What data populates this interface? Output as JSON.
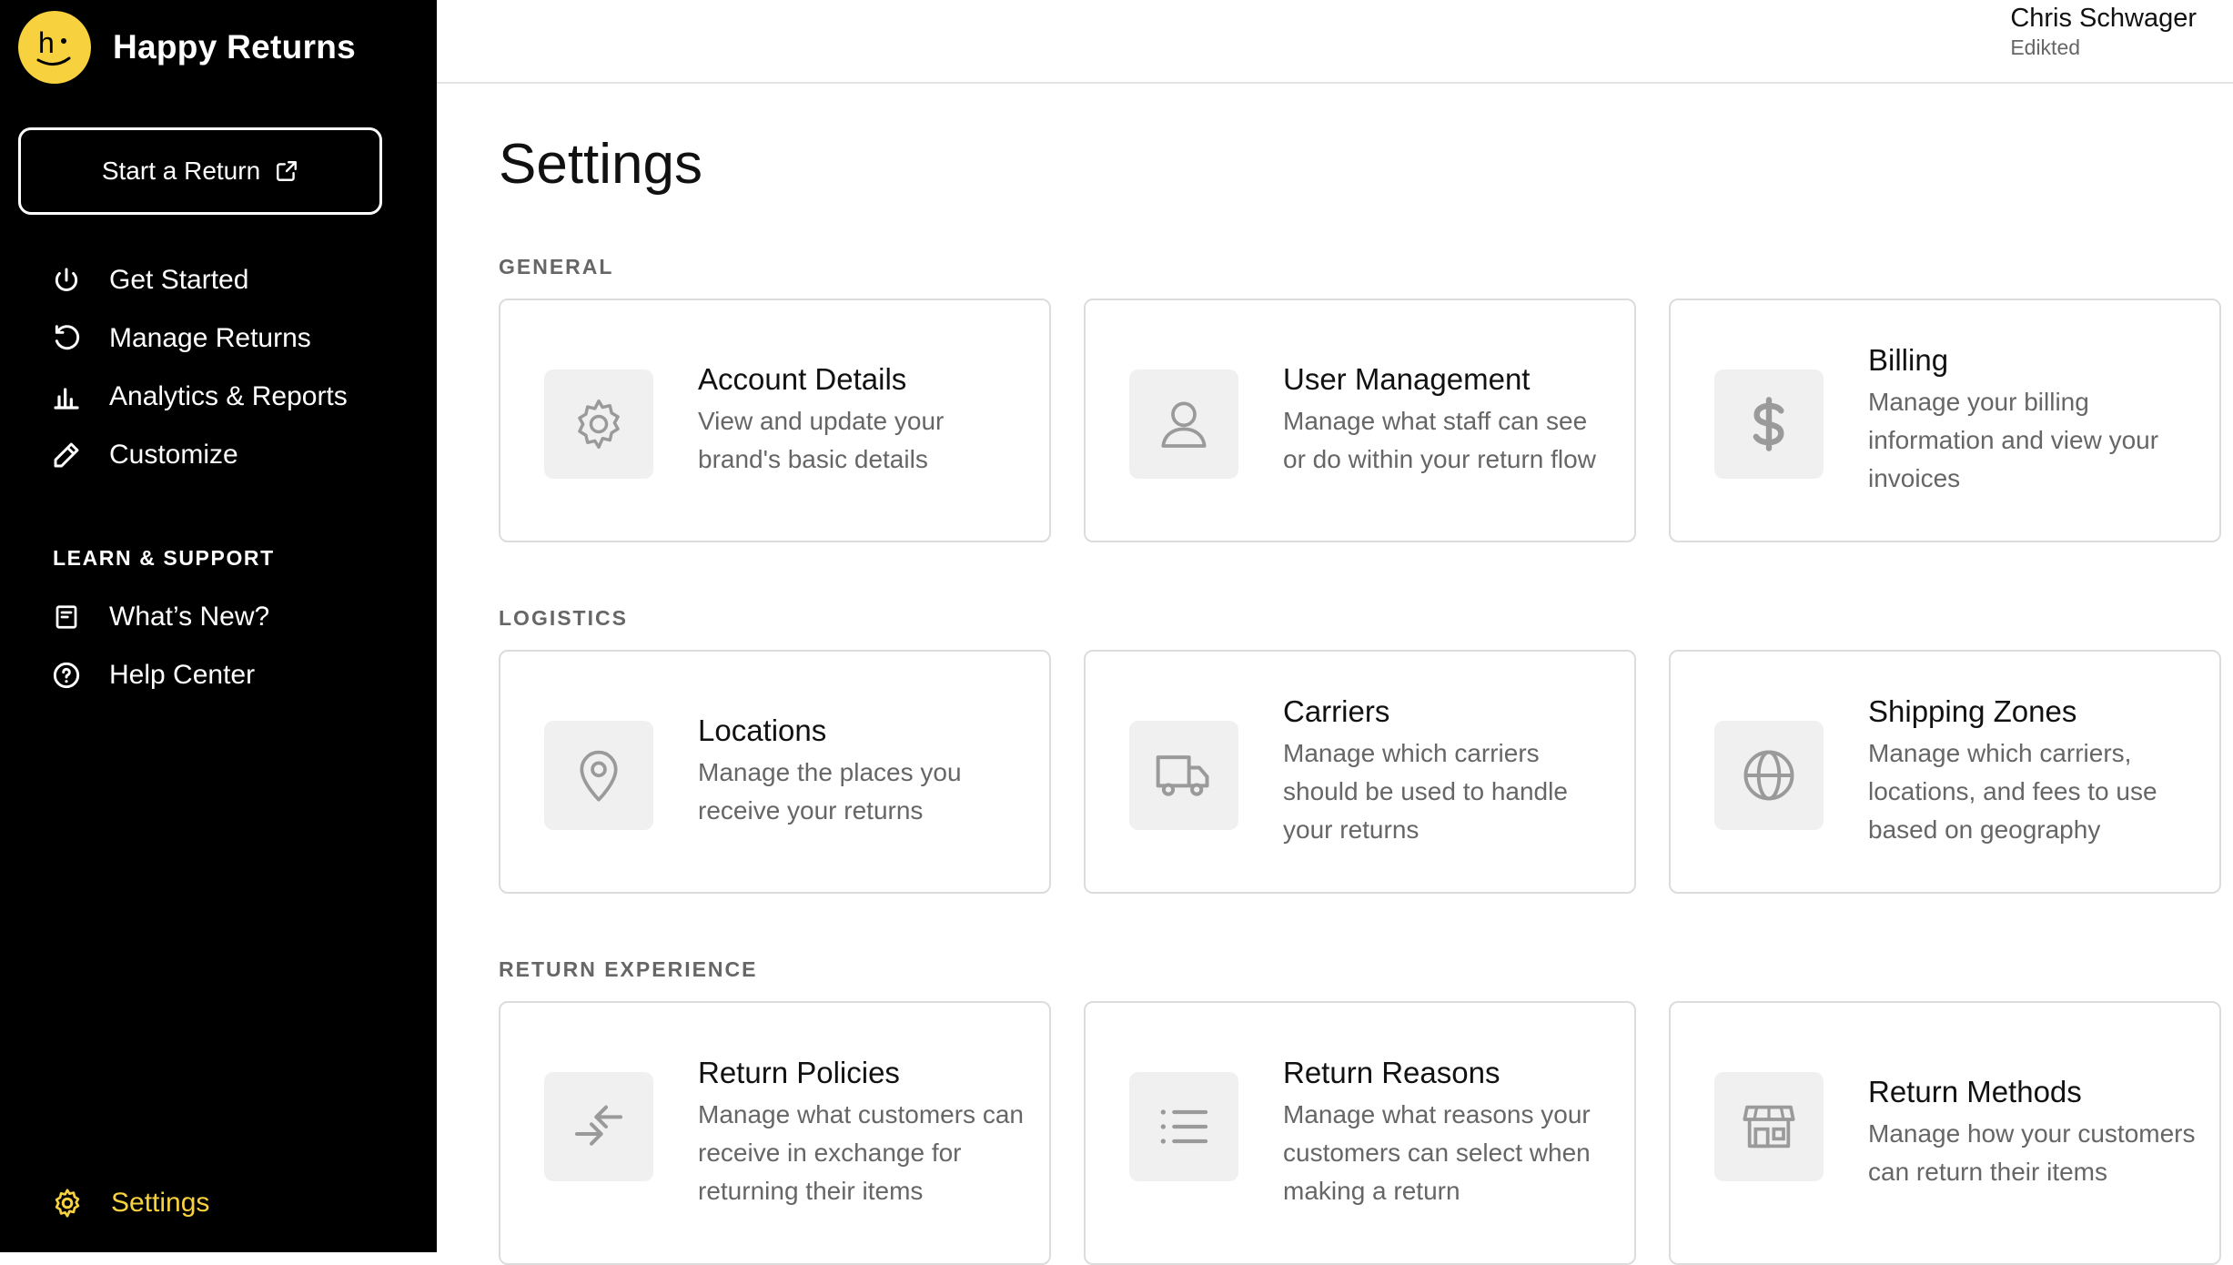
{
  "brand": {
    "name": "Happy Returns",
    "logo_text": "h",
    "accent_color": "#f7d23e"
  },
  "sidebar": {
    "start_return_label": "Start a Return",
    "items": [
      {
        "label": "Get Started",
        "icon": "power-icon"
      },
      {
        "label": "Manage Returns",
        "icon": "refresh-icon"
      },
      {
        "label": "Analytics & Reports",
        "icon": "bar-chart-icon"
      },
      {
        "label": "Customize",
        "icon": "pencil-icon"
      }
    ],
    "learn_title": "LEARN & SUPPORT",
    "learn_items": [
      {
        "label": "What’s New?",
        "icon": "document-icon"
      },
      {
        "label": "Help Center",
        "icon": "help-circle-icon"
      }
    ],
    "settings_label": "Settings"
  },
  "header": {
    "user_name": "Chris Schwager",
    "org_name": "Edikted"
  },
  "main": {
    "title": "Settings",
    "sections": [
      {
        "title": "GENERAL",
        "cards": [
          {
            "title": "Account Details",
            "description": "View and update your brand's basic details",
            "icon": "gear-icon"
          },
          {
            "title": "User Management",
            "description": "Manage what staff can see or do within your return flow",
            "icon": "user-icon"
          },
          {
            "title": "Billing",
            "description": "Manage your billing information and view your invoices",
            "icon": "dollar-icon"
          }
        ]
      },
      {
        "title": "LOGISTICS",
        "cards": [
          {
            "title": "Locations",
            "description": "Manage the places you receive your returns",
            "icon": "map-pin-icon"
          },
          {
            "title": "Carriers",
            "description": "Manage which carriers should be used to handle your returns",
            "icon": "truck-icon"
          },
          {
            "title": "Shipping Zones",
            "description": "Manage which carriers, locations, and fees to use based on geography",
            "icon": "globe-icon"
          }
        ]
      },
      {
        "title": "RETURN EXPERIENCE",
        "cards": [
          {
            "title": "Return Policies",
            "description": "Manage what customers can receive in exchange for returning their items",
            "icon": "exchange-arrows-icon"
          },
          {
            "title": "Return Reasons",
            "description": "Manage what reasons your customers can select when making a return",
            "icon": "list-icon"
          },
          {
            "title": "Return Methods",
            "description": "Manage how your customers can return their items",
            "icon": "storefront-icon"
          }
        ]
      }
    ]
  }
}
